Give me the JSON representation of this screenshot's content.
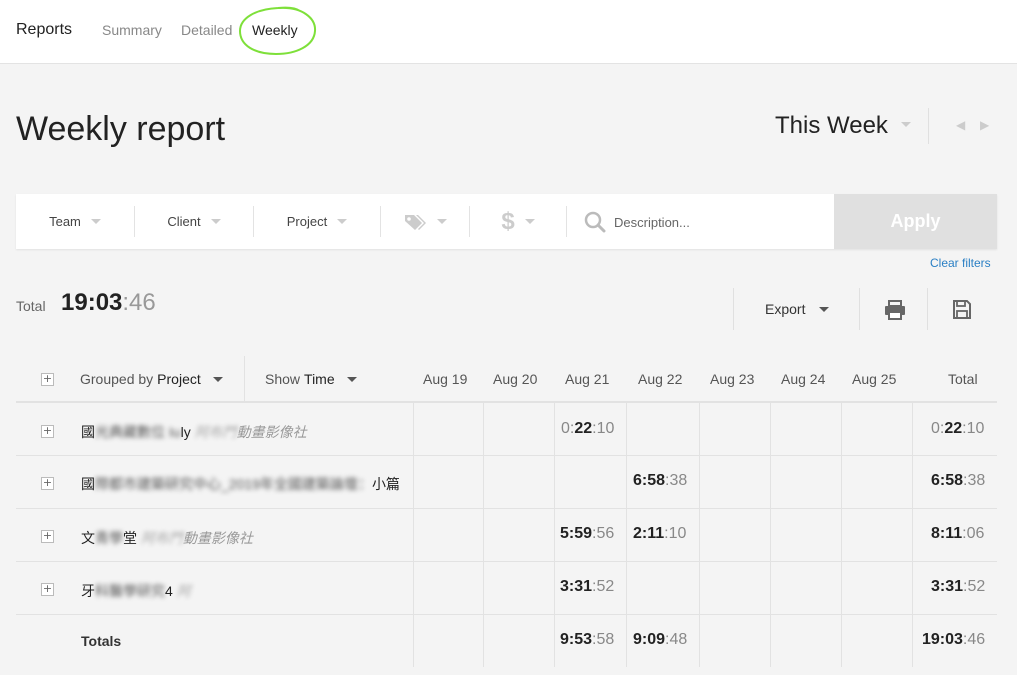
{
  "nav": {
    "brand": "Reports",
    "tabs": [
      {
        "label": "Summary"
      },
      {
        "label": "Detailed"
      },
      {
        "label": "Weekly"
      }
    ]
  },
  "header": {
    "title": "Weekly report",
    "period": "This Week"
  },
  "filters": {
    "team": "Team",
    "client": "Client",
    "project": "Project",
    "tags_icon": "tag-icon",
    "billable_icon": "dollar-icon",
    "search_icon": "search-icon",
    "description_placeholder": "Description...",
    "apply": "Apply",
    "clear": "Clear filters"
  },
  "summary": {
    "total_label": "Total",
    "total_hm": "19:03",
    "total_sec": ":46",
    "export": "Export",
    "print_icon": "printer-icon",
    "save_icon": "save-icon"
  },
  "table": {
    "grouped_prefix": "Grouped by ",
    "grouped_value": "Project",
    "show_prefix": "Show ",
    "show_value": "Time",
    "days": [
      "Aug 19",
      "Aug 20",
      "Aug 21",
      "Aug 22",
      "Aug 23",
      "Aug 24",
      "Aug 25"
    ],
    "total_header": "Total",
    "rows": [
      {
        "project_a": "國",
        "project_b": "光典藏數位 Iu",
        "project_c": "ly",
        "client_blur": "阿布門",
        "client": "動畫影像社",
        "aug21": {
          "h": "0:",
          "m": "22",
          "s": ":10"
        },
        "aug22": null,
        "total": {
          "h": "0:",
          "m": "22",
          "s": ":10"
        }
      },
      {
        "project_a": "國",
        "project_b": "際都市建築研究中心_2019年全國建築論壇：",
        "project_c": "小篇",
        "client_blur": "",
        "client": "",
        "aug21": null,
        "aug22": {
          "hm": "6:58",
          "s": ":38"
        },
        "total": {
          "hm": "6:58",
          "s": ":38"
        }
      },
      {
        "project_a": "文",
        "project_b": "青學",
        "project_c": "堂",
        "client_blur": "阿布門",
        "client": "動畫影像社",
        "aug21": {
          "hm": "5:59",
          "s": ":56"
        },
        "aug22": {
          "hm": "2:11",
          "s": ":10"
        },
        "total": {
          "hm": "8:11",
          "s": ":06"
        }
      },
      {
        "project_a": "牙",
        "project_b": "科醫學研究",
        "project_c": "4",
        "client_blur": "阿",
        "client": "",
        "aug21": {
          "hm": "3:31",
          "s": ":52"
        },
        "aug22": null,
        "total": {
          "hm": "3:31",
          "s": ":52"
        }
      }
    ],
    "totals": {
      "label": "Totals",
      "aug21": {
        "hm": "9:53",
        "s": ":58"
      },
      "aug22": {
        "hm": "9:09",
        "s": ":48"
      },
      "total": {
        "hm": "19:03",
        "s": ":46"
      }
    }
  },
  "colors": {
    "accent_ring": "#7ee03a",
    "link": "#2a7fc4",
    "apply_bg": "#e0e0e0"
  }
}
